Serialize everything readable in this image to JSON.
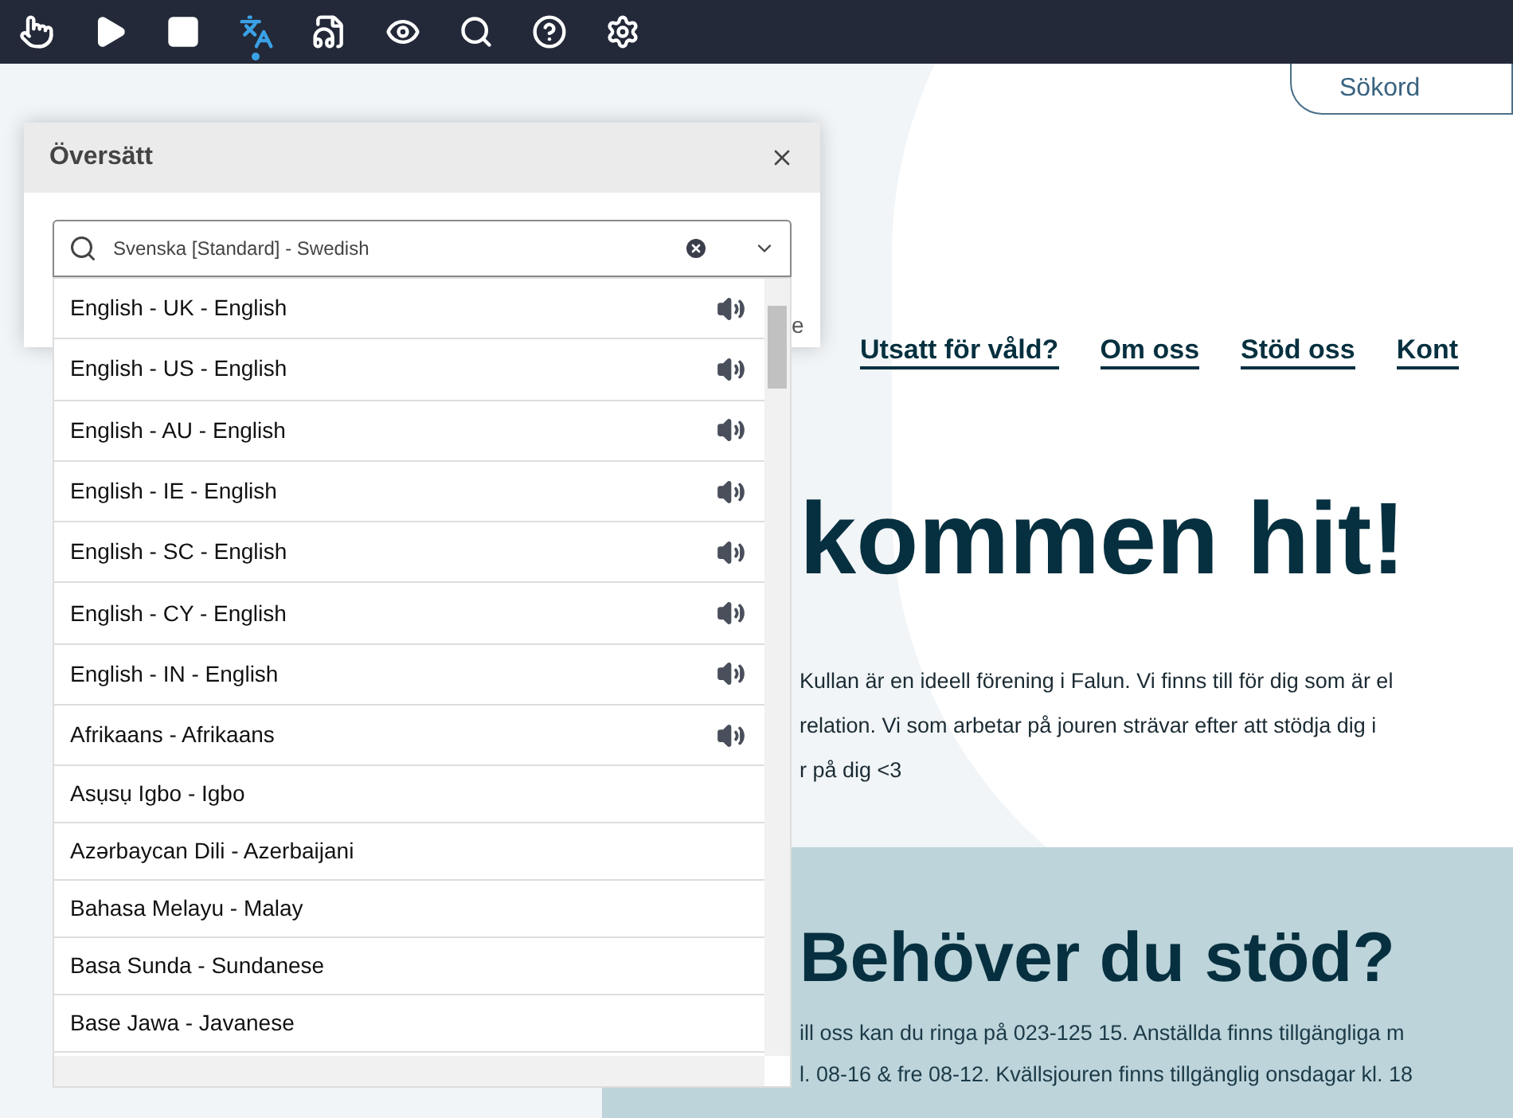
{
  "toolbar": {
    "items": [
      {
        "kind": "pointer",
        "selected": false
      },
      {
        "kind": "play",
        "selected": false
      },
      {
        "kind": "stop",
        "selected": false
      },
      {
        "kind": "translate",
        "selected": true
      },
      {
        "kind": "mp3",
        "selected": false
      },
      {
        "kind": "screen-mask",
        "selected": false
      },
      {
        "kind": "zoom-text",
        "selected": false
      },
      {
        "kind": "help",
        "selected": false
      },
      {
        "kind": "settings",
        "selected": false
      }
    ]
  },
  "page": {
    "search": {
      "placeholder": "Sökord"
    },
    "nav": [
      "Utsatt för våld?",
      "Om oss",
      "Stöd oss",
      "Kont"
    ],
    "hero": {
      "heading": "kommen hit!",
      "lines": [
        "Kullan är en ideell förening i Falun. Vi finns till för dig som är el",
        "relation. Vi som arbetar på jouren strävar efter att stödja dig i",
        "r på dig <3"
      ]
    },
    "support": {
      "heading": "Behöver du stöd?",
      "lines": [
        "ill oss kan du ringa på 023-125 15. Anställda finns tillgängliga m",
        "l. 08-16 & fre 08-12. Kvällsjouren finns tillgänglig onsdagar kl. 18"
      ]
    }
  },
  "dialog": {
    "title": "Översätt",
    "hint": "e",
    "language_field": {
      "value": "Svenska [Standard] - Swedish"
    },
    "languages": [
      {
        "label": "English - UK - English",
        "audio": true
      },
      {
        "label": "English - US - English",
        "audio": true
      },
      {
        "label": "English - AU - English",
        "audio": true
      },
      {
        "label": "English - IE - English",
        "audio": true
      },
      {
        "label": "English - SC - English",
        "audio": true
      },
      {
        "label": "English - CY - English",
        "audio": true
      },
      {
        "label": "English - IN - English",
        "audio": true
      },
      {
        "label": "Afrikaans - Afrikaans",
        "audio": true
      },
      {
        "label": "Asụsụ Igbo - Igbo",
        "audio": false
      },
      {
        "label": "Azərbaycan Dili - Azerbaijani",
        "audio": false
      },
      {
        "label": "Bahasa Melayu - Malay",
        "audio": false
      },
      {
        "label": "Basa Sunda - Sundanese",
        "audio": false
      },
      {
        "label": "Base Jawa - Javanese",
        "audio": false
      }
    ]
  }
}
